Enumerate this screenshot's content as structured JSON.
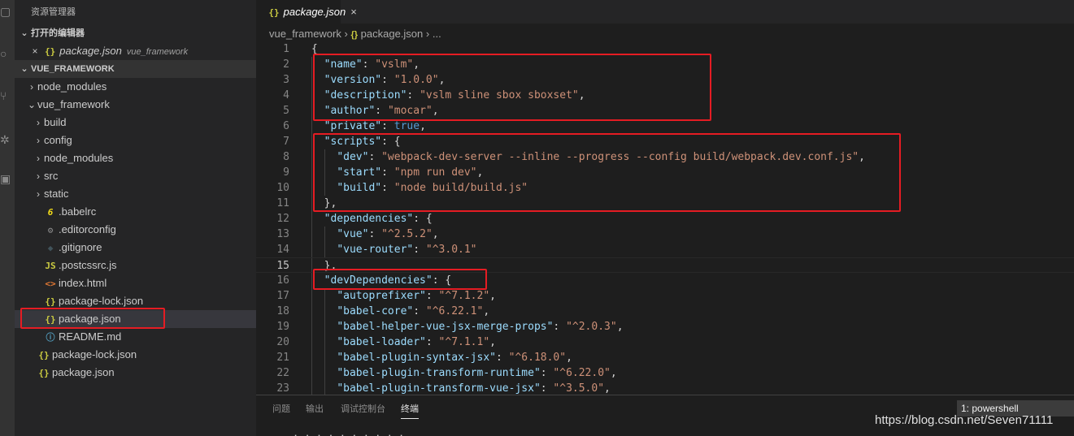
{
  "activity_bar": {
    "icons": [
      "files-icon",
      "search-icon",
      "source-control-icon",
      "debug-icon",
      "extensions-icon"
    ]
  },
  "sidebar": {
    "title": "资源管理器",
    "open_editors": {
      "header": "打开的编辑器",
      "items": [
        {
          "close": "×",
          "name": "package.json",
          "hint": "vue_framework"
        }
      ]
    },
    "workspace": {
      "header": "VUE_FRAMEWORK",
      "items": [
        {
          "depth": 1,
          "chev": "›",
          "icon": "",
          "name": "node_modules"
        },
        {
          "depth": 1,
          "chev": "⌄",
          "icon": "",
          "name": "vue_framework"
        },
        {
          "depth": 2,
          "chev": "›",
          "icon": "",
          "name": "build"
        },
        {
          "depth": 2,
          "chev": "›",
          "icon": "",
          "name": "config"
        },
        {
          "depth": 2,
          "chev": "›",
          "icon": "",
          "name": "node_modules"
        },
        {
          "depth": 2,
          "chev": "›",
          "icon": "",
          "name": "src"
        },
        {
          "depth": 2,
          "chev": "›",
          "icon": "",
          "name": "static"
        },
        {
          "depth": 2,
          "chev": "",
          "icon": "babel",
          "glyph": "6",
          "name": ".babelrc"
        },
        {
          "depth": 2,
          "chev": "",
          "icon": "gear",
          "glyph": "⚙",
          "name": ".editorconfig"
        },
        {
          "depth": 2,
          "chev": "",
          "icon": "git",
          "glyph": "◆",
          "name": ".gitignore"
        },
        {
          "depth": 2,
          "chev": "",
          "icon": "js",
          "glyph": "JS",
          "name": ".postcssrc.js"
        },
        {
          "depth": 2,
          "chev": "",
          "icon": "html",
          "glyph": "<>",
          "name": "index.html"
        },
        {
          "depth": 2,
          "chev": "",
          "icon": "json",
          "glyph": "{}",
          "name": "package-lock.json"
        },
        {
          "depth": 2,
          "chev": "",
          "icon": "json",
          "glyph": "{}",
          "name": "package.json",
          "selected": true
        },
        {
          "depth": 2,
          "chev": "",
          "icon": "info",
          "glyph": "ⓘ",
          "name": "README.md"
        },
        {
          "depth": 1,
          "chev": "",
          "icon": "json",
          "glyph": "{}",
          "name": "package-lock.json"
        },
        {
          "depth": 1,
          "chev": "",
          "icon": "json",
          "glyph": "{}",
          "name": "package.json"
        }
      ]
    }
  },
  "editor": {
    "tab": {
      "icon": "{}",
      "name": "package.json",
      "close": "×"
    },
    "breadcrumb": [
      "vue_framework",
      "›",
      "{}",
      "package.json",
      "›",
      "..."
    ],
    "current_line": 15,
    "lines": [
      {
        "n": "1",
        "tokens": [
          [
            "p",
            "{"
          ]
        ]
      },
      {
        "n": "2",
        "tokens": [
          [
            "p",
            "  "
          ],
          [
            "k",
            "\"name\""
          ],
          [
            "p",
            ": "
          ],
          [
            "s",
            "\"vslm\""
          ],
          [
            "p",
            ","
          ]
        ]
      },
      {
        "n": "3",
        "tokens": [
          [
            "p",
            "  "
          ],
          [
            "k",
            "\"version\""
          ],
          [
            "p",
            ": "
          ],
          [
            "s",
            "\"1.0.0\""
          ],
          [
            "p",
            ","
          ]
        ]
      },
      {
        "n": "4",
        "tokens": [
          [
            "p",
            "  "
          ],
          [
            "k",
            "\"description\""
          ],
          [
            "p",
            ": "
          ],
          [
            "s",
            "\"vslm sline sbox sboxset\""
          ],
          [
            "p",
            ","
          ]
        ]
      },
      {
        "n": "5",
        "tokens": [
          [
            "p",
            "  "
          ],
          [
            "k",
            "\"author\""
          ],
          [
            "p",
            ": "
          ],
          [
            "s",
            "\"mocar\""
          ],
          [
            "p",
            ","
          ]
        ]
      },
      {
        "n": "6",
        "tokens": [
          [
            "p",
            "  "
          ],
          [
            "k",
            "\"private\""
          ],
          [
            "p",
            ": "
          ],
          [
            "b",
            "true"
          ],
          [
            "p",
            ","
          ]
        ]
      },
      {
        "n": "7",
        "tokens": [
          [
            "p",
            "  "
          ],
          [
            "k",
            "\"scripts\""
          ],
          [
            "p",
            ": {"
          ]
        ]
      },
      {
        "n": "8",
        "tokens": [
          [
            "p",
            "    "
          ],
          [
            "k",
            "\"dev\""
          ],
          [
            "p",
            ": "
          ],
          [
            "s",
            "\"webpack-dev-server --inline --progress --config build/webpack.dev.conf.js\""
          ],
          [
            "p",
            ","
          ]
        ]
      },
      {
        "n": "9",
        "tokens": [
          [
            "p",
            "    "
          ],
          [
            "k",
            "\"start\""
          ],
          [
            "p",
            ": "
          ],
          [
            "s",
            "\"npm run dev\""
          ],
          [
            "p",
            ","
          ]
        ]
      },
      {
        "n": "10",
        "tokens": [
          [
            "p",
            "    "
          ],
          [
            "k",
            "\"build\""
          ],
          [
            "p",
            ": "
          ],
          [
            "s",
            "\"node build/build.js\""
          ]
        ]
      },
      {
        "n": "11",
        "tokens": [
          [
            "p",
            "  },"
          ]
        ]
      },
      {
        "n": "12",
        "tokens": [
          [
            "p",
            "  "
          ],
          [
            "k",
            "\"dependencies\""
          ],
          [
            "p",
            ": {"
          ]
        ]
      },
      {
        "n": "13",
        "tokens": [
          [
            "p",
            "    "
          ],
          [
            "k",
            "\"vue\""
          ],
          [
            "p",
            ": "
          ],
          [
            "s",
            "\"^2.5.2\""
          ],
          [
            "p",
            ","
          ]
        ]
      },
      {
        "n": "14",
        "tokens": [
          [
            "p",
            "    "
          ],
          [
            "k",
            "\"vue-router\""
          ],
          [
            "p",
            ": "
          ],
          [
            "s",
            "\"^3.0.1\""
          ]
        ]
      },
      {
        "n": "15",
        "tokens": [
          [
            "p",
            "  },"
          ]
        ]
      },
      {
        "n": "16",
        "tokens": [
          [
            "p",
            "  "
          ],
          [
            "k",
            "\"devDependencies\""
          ],
          [
            "p",
            ": {"
          ]
        ]
      },
      {
        "n": "17",
        "tokens": [
          [
            "p",
            "    "
          ],
          [
            "k",
            "\"autoprefixer\""
          ],
          [
            "p",
            ": "
          ],
          [
            "s",
            "\"^7.1.2\""
          ],
          [
            "p",
            ","
          ]
        ]
      },
      {
        "n": "18",
        "tokens": [
          [
            "p",
            "    "
          ],
          [
            "k",
            "\"babel-core\""
          ],
          [
            "p",
            ": "
          ],
          [
            "s",
            "\"^6.22.1\""
          ],
          [
            "p",
            ","
          ]
        ]
      },
      {
        "n": "19",
        "tokens": [
          [
            "p",
            "    "
          ],
          [
            "k",
            "\"babel-helper-vue-jsx-merge-props\""
          ],
          [
            "p",
            ": "
          ],
          [
            "s",
            "\"^2.0.3\""
          ],
          [
            "p",
            ","
          ]
        ]
      },
      {
        "n": "20",
        "tokens": [
          [
            "p",
            "    "
          ],
          [
            "k",
            "\"babel-loader\""
          ],
          [
            "p",
            ": "
          ],
          [
            "s",
            "\"^7.1.1\""
          ],
          [
            "p",
            ","
          ]
        ]
      },
      {
        "n": "21",
        "tokens": [
          [
            "p",
            "    "
          ],
          [
            "k",
            "\"babel-plugin-syntax-jsx\""
          ],
          [
            "p",
            ": "
          ],
          [
            "s",
            "\"^6.18.0\""
          ],
          [
            "p",
            ","
          ]
        ]
      },
      {
        "n": "22",
        "tokens": [
          [
            "p",
            "    "
          ],
          [
            "k",
            "\"babel-plugin-transform-runtime\""
          ],
          [
            "p",
            ": "
          ],
          [
            "s",
            "\"^6.22.0\""
          ],
          [
            "p",
            ","
          ]
        ]
      },
      {
        "n": "23",
        "tokens": [
          [
            "p",
            "    "
          ],
          [
            "k",
            "\"babel-plugin-transform-vue-jsx\""
          ],
          [
            "p",
            ": "
          ],
          [
            "s",
            "\"^3.5.0\""
          ],
          [
            "p",
            ","
          ]
        ]
      }
    ]
  },
  "panel": {
    "tabs": [
      {
        "label": "问题",
        "active": false
      },
      {
        "label": "输出",
        "active": false
      },
      {
        "label": "调试控制台",
        "active": false
      },
      {
        "label": "终端",
        "active": true
      }
    ],
    "terminal_select": "1: powershell",
    "terminal_text": "· · · · · · · · · ·"
  },
  "watermark": "https://blog.csdn.net/Seven71111",
  "colors": {
    "highlight_box": "#e51c23",
    "json_key": "#9cdcfe",
    "json_string": "#ce9178",
    "json_bool": "#569cd6"
  }
}
